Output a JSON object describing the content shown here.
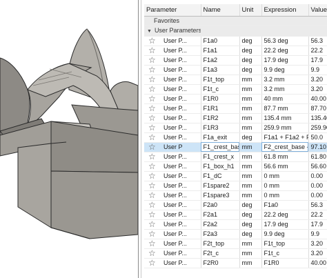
{
  "columns": {
    "parameter": "Parameter",
    "name": "Name",
    "unit": "Unit",
    "expression": "Expression",
    "value": "Value"
  },
  "groups": {
    "favorites": "Favorites",
    "user_parameters": "User Parameters"
  },
  "rows": [
    {
      "param": "User P...",
      "name": "F1a0",
      "unit": "deg",
      "expr": "56.3 deg",
      "value": "56.3"
    },
    {
      "param": "User P...",
      "name": "F1a1",
      "unit": "deg",
      "expr": "22.2 deg",
      "value": "22.2"
    },
    {
      "param": "User P...",
      "name": "F1a2",
      "unit": "deg",
      "expr": "17.9 deg",
      "value": "17.9"
    },
    {
      "param": "User P...",
      "name": "F1a3",
      "unit": "deg",
      "expr": "9.9 deg",
      "value": "9.9"
    },
    {
      "param": "User P...",
      "name": "F1t_top",
      "unit": "mm",
      "expr": "3.2 mm",
      "value": "3.20"
    },
    {
      "param": "User P...",
      "name": "F1t_c",
      "unit": "mm",
      "expr": "3.2 mm",
      "value": "3.20"
    },
    {
      "param": "User P...",
      "name": "F1R0",
      "unit": "mm",
      "expr": "40 mm",
      "value": "40.00"
    },
    {
      "param": "User P...",
      "name": "F1R1",
      "unit": "mm",
      "expr": "87.7 mm",
      "value": "87.70"
    },
    {
      "param": "User P...",
      "name": "F1R2",
      "unit": "mm",
      "expr": "135.4 mm",
      "value": "135.40"
    },
    {
      "param": "User P...",
      "name": "F1R3",
      "unit": "mm",
      "expr": "259.9 mm",
      "value": "259.90"
    },
    {
      "param": "User P...",
      "name": "F1a_exit",
      "unit": "deg",
      "expr": "F1a1 + F1a2 + F...",
      "value": "50.0"
    },
    {
      "param": "User P",
      "name": "F1_crest_base",
      "unit": "mm",
      "expr": "F2_crest_base - ...",
      "value": "97.10"
    },
    {
      "param": "User P...",
      "name": "F1_crest_x",
      "unit": "mm",
      "expr": "61.8 mm",
      "value": "61.80"
    },
    {
      "param": "User P...",
      "name": "F1_box_h1",
      "unit": "mm",
      "expr": "56.6 mm",
      "value": "56.60"
    },
    {
      "param": "User P...",
      "name": "F1_dC",
      "unit": "mm",
      "expr": "0 mm",
      "value": "0.00"
    },
    {
      "param": "User P...",
      "name": "F1spare2",
      "unit": "mm",
      "expr": "0 mm",
      "value": "0.00"
    },
    {
      "param": "User P...",
      "name": "F1spare3",
      "unit": "mm",
      "expr": "0 mm",
      "value": "0.00"
    },
    {
      "param": "User P...",
      "name": "F2a0",
      "unit": "deg",
      "expr": "F1a0",
      "value": "56.3"
    },
    {
      "param": "User P...",
      "name": "F2a1",
      "unit": "deg",
      "expr": "22.2 deg",
      "value": "22.2"
    },
    {
      "param": "User P...",
      "name": "F2a2",
      "unit": "deg",
      "expr": "17.9 deg",
      "value": "17.9"
    },
    {
      "param": "User P...",
      "name": "F2a3",
      "unit": "deg",
      "expr": "9.9 deg",
      "value": "9.9"
    },
    {
      "param": "User P...",
      "name": "F2t_top",
      "unit": "mm",
      "expr": "F1t_top",
      "value": "3.20"
    },
    {
      "param": "User P...",
      "name": "F2t_c",
      "unit": "mm",
      "expr": "F1t_c",
      "value": "3.20"
    },
    {
      "param": "User P...",
      "name": "F2R0",
      "unit": "mm",
      "expr": "F1R0",
      "value": "40.00"
    }
  ],
  "selected_row": 11,
  "icons": {
    "favorite": "star-outline-icon",
    "expand": "chevron-down-icon"
  },
  "colors": {
    "model_face": "#a7a49e",
    "model_edge": "#2a2a2a",
    "selection": "#cde4f7"
  }
}
